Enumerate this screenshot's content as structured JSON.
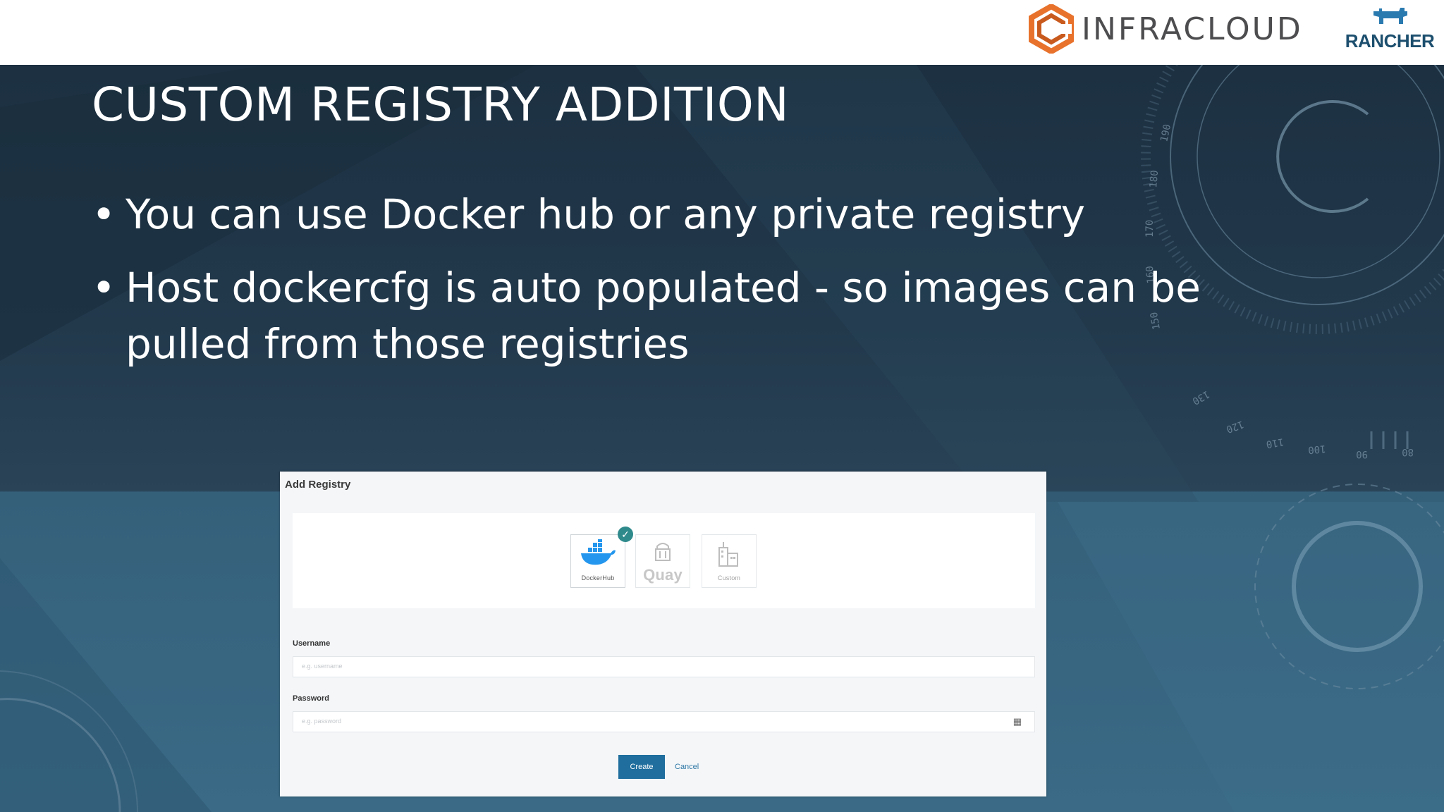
{
  "header": {
    "infracloud_logo_text": "INFRACLOUD",
    "rancher_logo_text": "RANCHER"
  },
  "slide": {
    "title": "CUSTOM REGISTRY ADDITION",
    "bullet_glyph": "•",
    "bullets": [
      "You can use Docker hub or any private registry",
      "Host dockercfg is auto populated - so images can be pulled from those registries"
    ]
  },
  "dialog": {
    "title": "Add Registry",
    "registry_options": [
      {
        "label": "DockerHub",
        "icon": "docker-whale-icon",
        "selected": true
      },
      {
        "label": "Quay",
        "icon": "quay-icon",
        "selected": false
      },
      {
        "label": "Custom",
        "icon": "custom-building-icon",
        "selected": false
      }
    ],
    "username_label": "Username",
    "username_placeholder": "e.g. username",
    "password_label": "Password",
    "password_placeholder": "e.g. password",
    "create_label": "Create",
    "cancel_label": "Cancel"
  },
  "decor": {
    "dial_numbers": [
      "190",
      "180",
      "170",
      "160",
      "150",
      "130",
      "120",
      "110",
      "100",
      "90",
      "80"
    ]
  },
  "colors": {
    "slide_dark": "#1c3041",
    "slide_light": "#3a6a86",
    "accent_blue": "#1f6e9e",
    "check_teal": "#2f8a8c",
    "infracloud_orange": "#e8722c",
    "rancher_blue": "#1d4f6e"
  }
}
